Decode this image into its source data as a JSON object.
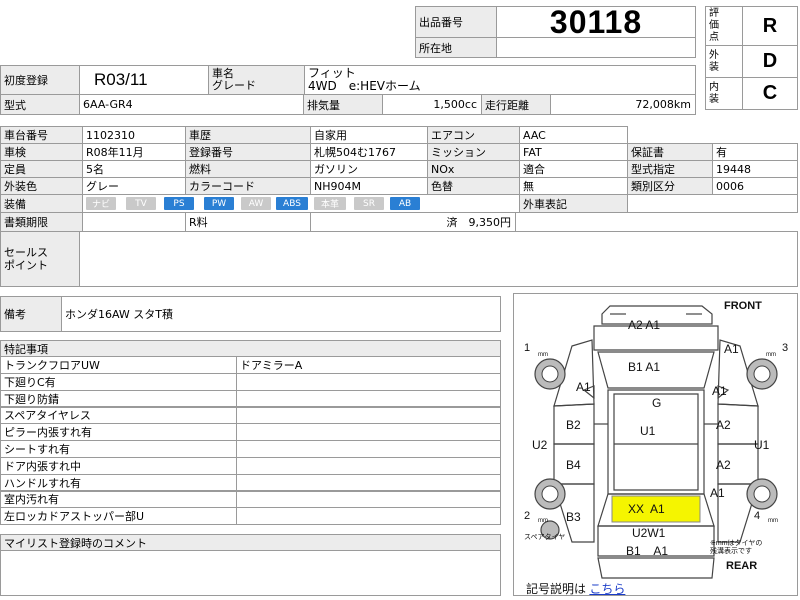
{
  "lot": {
    "label": "出品番号",
    "number": "30118",
    "location_label": "所在地",
    "location_value": ""
  },
  "grades": {
    "overall_label": "評\n価\n点",
    "overall": "R",
    "exterior_label": "外\n装",
    "exterior": "D",
    "interior_label": "内\n装",
    "interior": "C"
  },
  "basic": {
    "first_reg_label": "初度登録",
    "first_reg": "R03/11",
    "name_label": "車名\nグレード",
    "name_value": "フィット\n4WD　e:HEVホーム",
    "model_label": "型式",
    "model": "6AA-GR4",
    "displacement_label": "排気量",
    "displacement": "1,500cc",
    "mileage_label": "走行距離",
    "mileage": "72,008km"
  },
  "spec": {
    "chassis_label": "車台番号",
    "chassis": "1102310",
    "history_label": "車歴",
    "history": "自家用",
    "ac_label": "エアコン",
    "ac": "AAC",
    "inspection_label": "車検",
    "inspection": "R08年11月",
    "reg_no_label": "登録番号",
    "reg_no": "札幌504む1767",
    "mission_label": "ミッション",
    "mission": "FAT",
    "warranty_label": "保証書",
    "warranty": "有",
    "capacity_label": "定員",
    "capacity": "5名",
    "fuel_label": "燃料",
    "fuel": "ガソリン",
    "nox_label": "NOx",
    "nox": "",
    "conform_label": "適合",
    "conform": "",
    "type_designation_label": "型式指定",
    "type_designation": "19448",
    "color_label": "外装色",
    "color": "グレー",
    "color_code_label": "カラーコード",
    "color_code": "NH904M",
    "repaint_label": "色替",
    "repaint": "無",
    "class_label": "類別区分",
    "class": "0006",
    "equipment_label": "装備",
    "foreign_label": "外車表記",
    "foreign": "",
    "docs_label": "書類期限",
    "r_fee_label": "R料",
    "r_fee_value": "済　9,350円"
  },
  "equipment": [
    {
      "label": "ナビ",
      "on": false
    },
    {
      "label": "TV",
      "on": false
    },
    {
      "label": "PS",
      "on": true
    },
    {
      "label": "PW",
      "on": true
    },
    {
      "label": "AW",
      "on": false
    },
    {
      "label": "ABS",
      "on": true
    },
    {
      "label": "本革",
      "on": false
    },
    {
      "label": "SR",
      "on": false
    },
    {
      "label": "AB",
      "on": true
    }
  ],
  "sales_point_label": "セールス\nポイント",
  "notes": {
    "label": "備考",
    "value": "ホンダ16AW スタT積"
  },
  "special": {
    "label": "特記事項",
    "rows": [
      [
        "トランクフロアUW",
        "ドアミラーA"
      ],
      [
        "下廻りC有",
        ""
      ],
      [
        "下廻り防錆",
        ""
      ],
      [
        "スペアタイヤレス",
        ""
      ],
      [
        "ピラー内張すれ有",
        ""
      ],
      [
        "シートすれ有",
        ""
      ],
      [
        "ドア内張すれ中",
        ""
      ],
      [
        "ハンドルすれ有",
        ""
      ],
      [
        "室内汚れ有",
        ""
      ],
      [
        "左ロッカドアストッパー部U",
        ""
      ]
    ]
  },
  "mylist_label": "マイリスト登録時のコメント",
  "diagram": {
    "front": "FRONT",
    "rear": "REAR",
    "hood": "A2 A1",
    "windshield": "B1 A1",
    "roof": "G",
    "cabin": "U1",
    "left_front_fender": "A1",
    "left_front_door": "B2",
    "left_rear_door": "B4",
    "left_rocker": "U2",
    "left_rear_fender": "B3",
    "right_front_fender": "A1",
    "right_front_door": "A2",
    "right_rear_door": "A2",
    "right_rocker": "U1",
    "right_rear_fender": "A1",
    "right_front_pillar": "A1",
    "trunk": "XX  A1",
    "rear_panel": "U2W1",
    "rear_bumper": "B1    A1",
    "wheel1": "1",
    "wheel2": "2",
    "wheel3": "3",
    "wheel4": "4",
    "mm": "mm",
    "spare": "スペアタイヤ",
    "note": "※mmはタイヤの\n残溝表示です",
    "legend_label": "記号説明は",
    "legend_link": "こちら"
  },
  "colors": {
    "badge_on": "#2a7fd4",
    "badge_off": "#c9c9c9",
    "highlight": "#f5f500",
    "grid": "#9a9a9a",
    "label_bg": "#ececec"
  }
}
